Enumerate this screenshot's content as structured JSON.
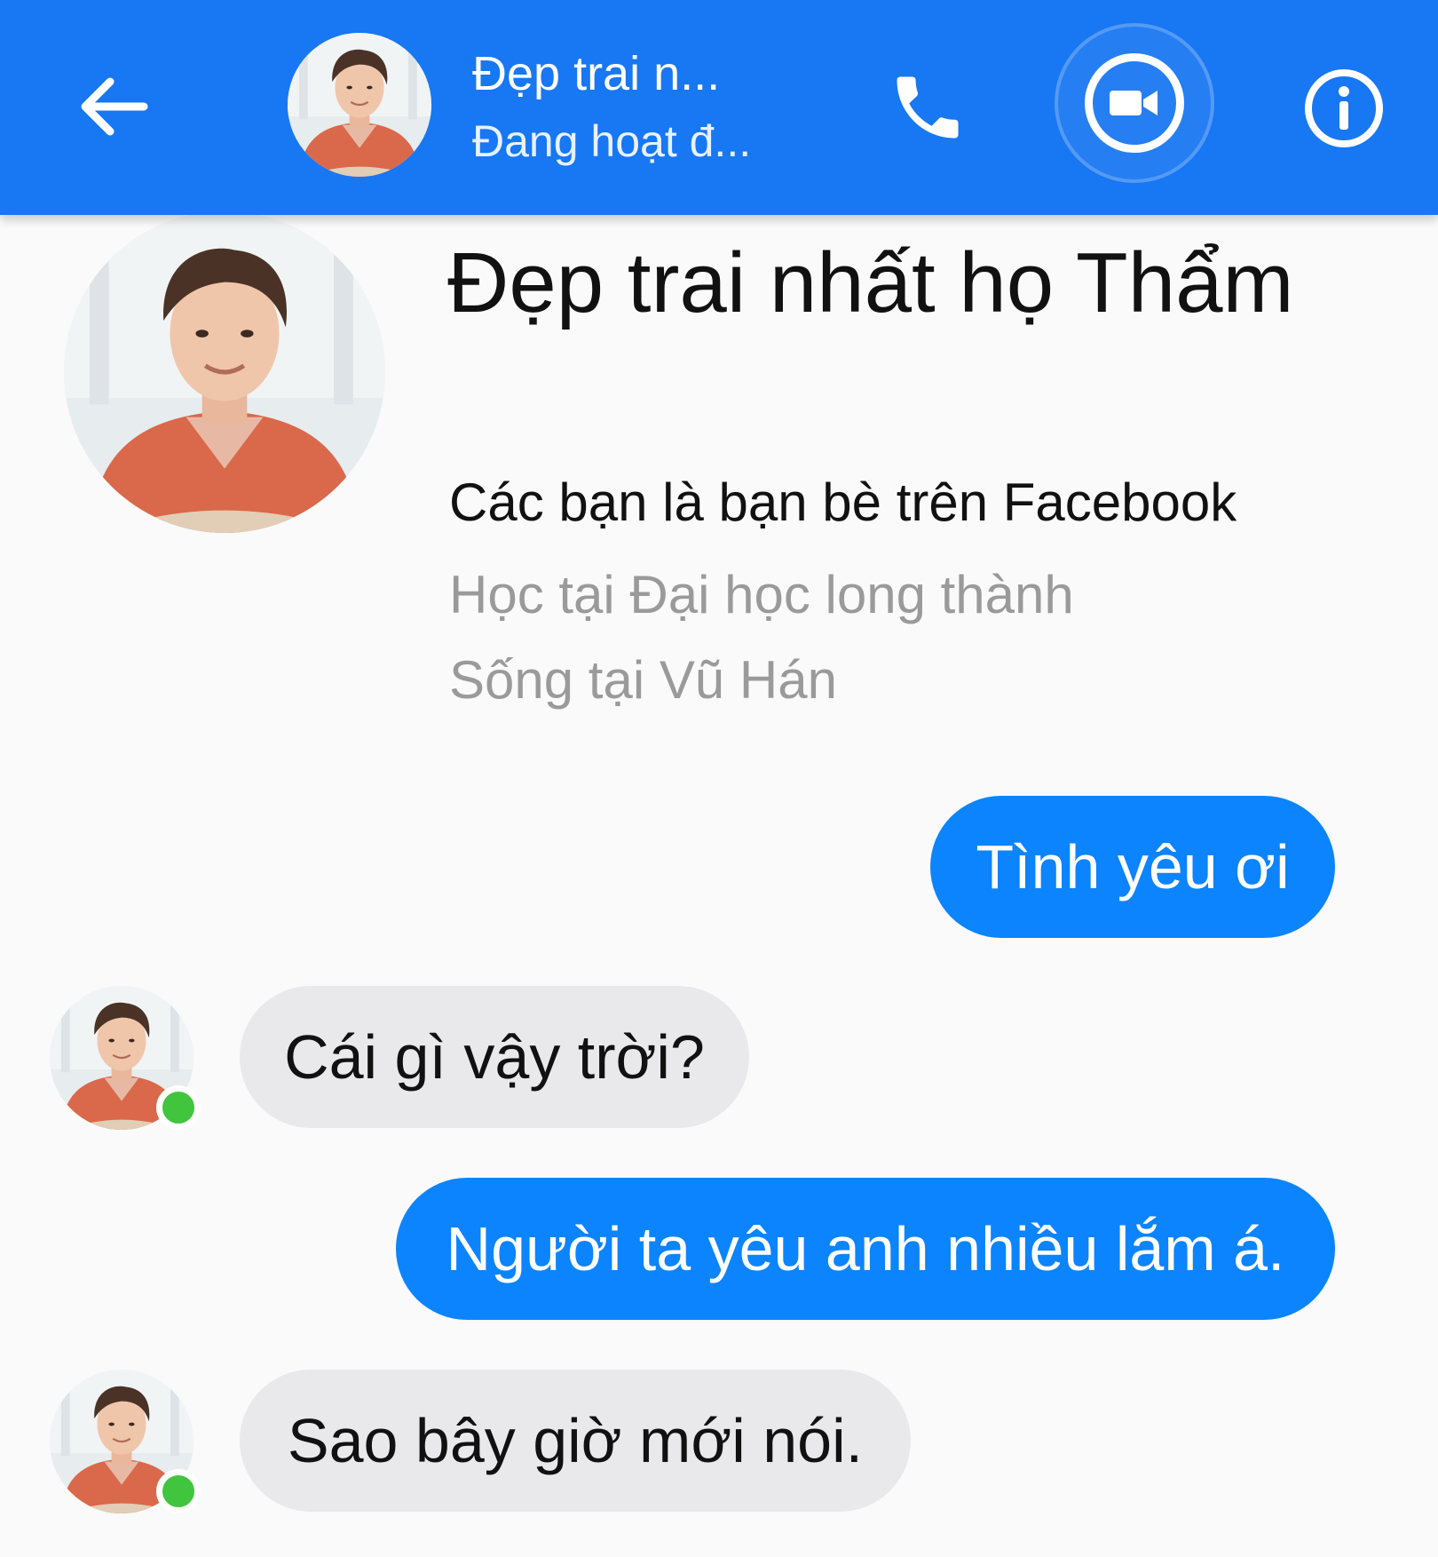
{
  "header": {
    "title": "Đẹp trai n...",
    "status": "Đang hoạt đ...",
    "icons": {
      "back": "arrow-left-icon",
      "call": "phone-icon",
      "video": "video-camera-icon",
      "info": "info-icon"
    },
    "background_color": "#1877f2"
  },
  "profile": {
    "name": "Đẹp trai nhất họ Thẩm",
    "friend_note": "Các bạn là bạn bè trên Facebook",
    "study": "Học tại Đại học long thành",
    "home": "Sống tại Vũ Hán"
  },
  "messages": [
    {
      "sender": "me",
      "text": "Tình yêu ơi"
    },
    {
      "sender": "contact",
      "text": "Cái gì vậy trời?"
    },
    {
      "sender": "me",
      "text": "Người ta yêu anh nhiều lắm á."
    },
    {
      "sender": "contact",
      "text": "Sao bây giờ mới nói."
    }
  ],
  "colors": {
    "sent_bubble": "#0b84fe",
    "received_bubble": "#e9e9eb",
    "online_indicator": "#41c53e"
  }
}
